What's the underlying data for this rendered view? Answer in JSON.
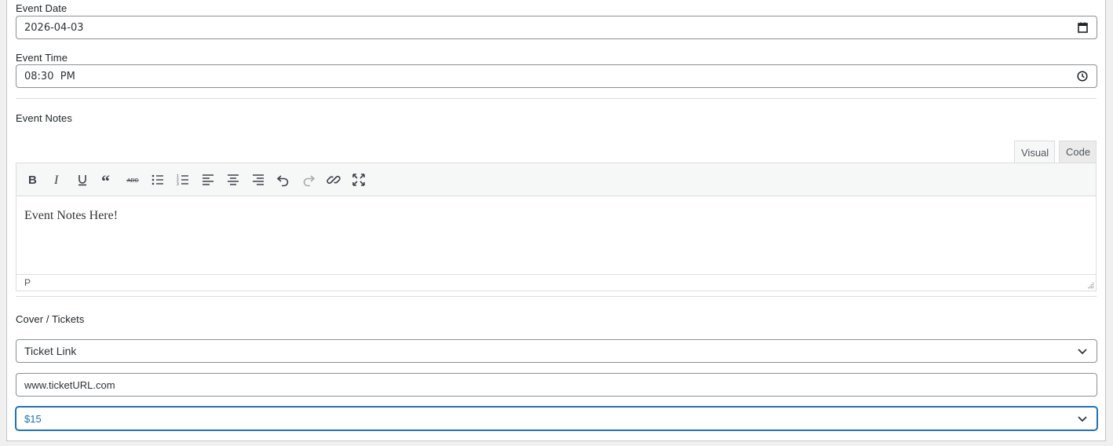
{
  "event_date": {
    "label": "Event Date",
    "value": "2026-04-03",
    "icon": "calendar-icon"
  },
  "event_time": {
    "label": "Event Time",
    "value": "08:30  PM",
    "icon": "clock-icon"
  },
  "event_notes": {
    "label": "Event Notes",
    "tabs": {
      "visual": "Visual",
      "code": "Code"
    },
    "toolbar": [
      "bold-icon",
      "italic-icon",
      "underline-icon",
      "blockquote-icon",
      "strikethrough-icon",
      "bullet-list-icon",
      "numbered-list-icon",
      "align-left-icon",
      "align-center-icon",
      "align-right-icon",
      "undo-icon",
      "redo-icon",
      "link-icon",
      "fullscreen-icon"
    ],
    "content": "Event Notes Here!",
    "status_path": "P"
  },
  "cover": {
    "label": "Cover / Tickets",
    "type_select": "Ticket Link",
    "url_value": "www.ticketURL.com",
    "price_select": "$15"
  },
  "colors": {
    "focus": "#2271b1",
    "border": "#8c8f94"
  }
}
